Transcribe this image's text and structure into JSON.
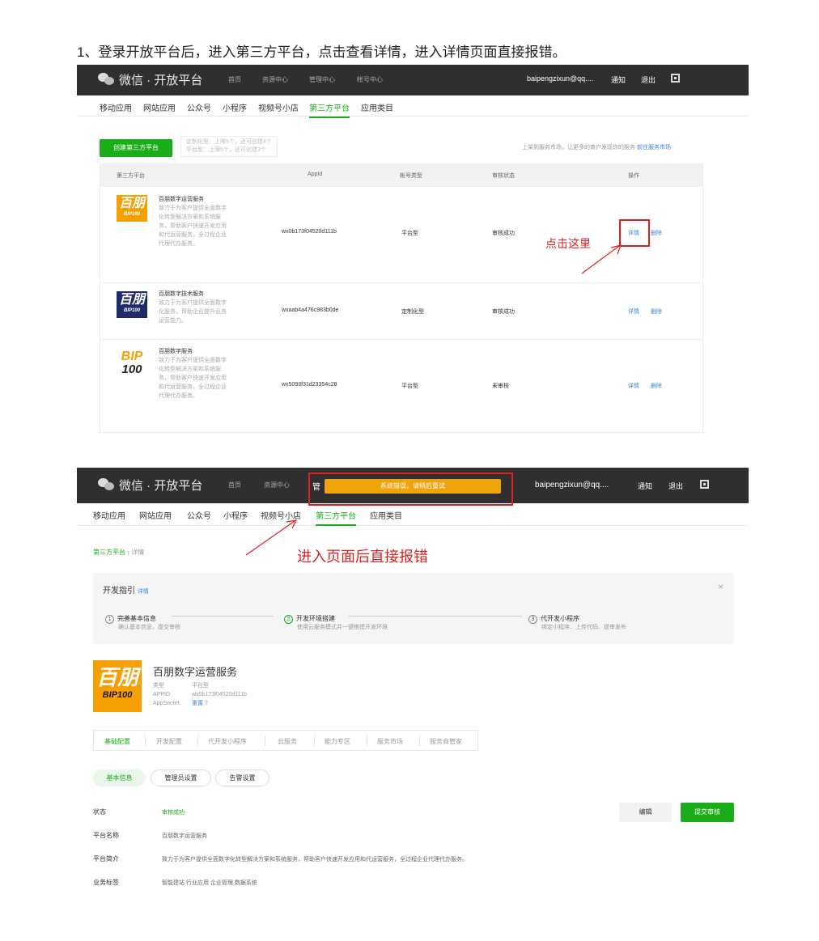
{
  "heading": "1、登录开放平台后，进入第三方平台，点击查看详情，进入详情页面直接报错。",
  "topbar": {
    "brand": "微信 · 开放平台",
    "nav": [
      "首页",
      "资源中心",
      "管理中心",
      "帐号中心"
    ],
    "account": "baipengzixun@qq....",
    "notice": "通知",
    "logout": "退出"
  },
  "subnav": [
    "移动应用",
    "网站应用",
    "公众号",
    "小程序",
    "视频号小店",
    "第三方平台",
    "应用类目"
  ],
  "list_page": {
    "create_button": "创建第三方平台",
    "quota_line1": "定制化型：上限5个，还可创建4个",
    "quota_line2": "平台型：上限5个，还可创建3个",
    "market_note": "上架到服务市场，让更多的商户发现你的服务",
    "market_link": "前往服务市场",
    "columns": [
      "第三方平台",
      "AppId",
      "帐号类型",
      "审核状态",
      "操作"
    ],
    "rows": [
      {
        "logo_top": "百朋",
        "logo_bottom": "BIP100",
        "name": "百朋数字运营服务",
        "desc": "致力于为客户提供全面数字化转型解决方案和系统服务，帮助客户快速开发应用和代运营服务，全过程企业代理代办服务。",
        "appid": "wx0b173f04520d111b",
        "type": "平台型",
        "status": "审核成功",
        "detail": "详情",
        "delete": "删除"
      },
      {
        "logo_top": "百朋",
        "logo_bottom": "BIP100",
        "name": "百朋数字技术服务",
        "desc": "致力于为客户提供全面数字化服务，帮助企业提升业务运营能力。",
        "appid": "wxaab4a476c983b0de",
        "type": "定制化型",
        "status": "审核成功",
        "detail": "详情",
        "delete": "删除"
      },
      {
        "logo_top": "BIP",
        "logo_bottom": "100",
        "name": "百朋数字服务",
        "desc": "致力于为客户提供全面数字化转型解决方案和系统服务，帮助客户快速开发应用和代运营服务，全过程企业代理代办服务。",
        "appid": "wx5093f31d23354c28",
        "type": "平台型",
        "status": "未审核",
        "detail": "详情",
        "delete": "删除"
      }
    ],
    "annotation": "点击这里"
  },
  "detail_page": {
    "partial_nav": "管",
    "error_toast": "系统错误，请稍后重试",
    "annotation": "进入页面后直接报错",
    "breadcrumb_root": "第三方平台",
    "breadcrumb_sep": "›",
    "breadcrumb_current": "详情",
    "guide_title": "开发指引",
    "guide_link": "详情",
    "close": "×",
    "steps": [
      {
        "num": "1",
        "title": "完善基本信息",
        "desc": "确认基本信息、提交审核"
      },
      {
        "num": "2",
        "title": "开发环境搭建",
        "desc": "使用云服务模式并一键搭建开发环境"
      },
      {
        "num": "3",
        "title": "代开发小程序",
        "desc": "绑定小程序、上传代码、提审发布"
      }
    ],
    "logo_top": "百朋",
    "logo_bottom": "BIP100",
    "platform_name": "百朋数字运营服务",
    "type_label": "类型",
    "type_value": "平台型",
    "appid_label": "APPID",
    "appid_value": "wx0b173f04520d111b",
    "secret_label": "AppSecret",
    "secret_action": "重置",
    "tabs": [
      "基础配置",
      "开发配置",
      "代开发小程序",
      "云服务",
      "能力专区",
      "服务市场",
      "服务商管家"
    ],
    "sub_tabs": [
      "基本信息",
      "管理员设置",
      "告警设置"
    ],
    "edit_button": "编辑",
    "submit_button": "提交审核",
    "fields": [
      {
        "label": "状态",
        "value": "审核成功"
      },
      {
        "label": "平台名称",
        "value": "百朋数字运营服务"
      },
      {
        "label": "平台简介",
        "value": "致力于为客户提供全面数字化转型解决方案和系统服务，帮助客户快速开发应用和代运营服务，全过程企业代理代办服务。"
      },
      {
        "label": "业务标签",
        "value": "智能建站 行业应用 企业管理 数据系统"
      }
    ]
  },
  "colors": {
    "brand_green": "#1aad19",
    "link_blue": "#3b86d6",
    "annotation_red": "#e02020",
    "toast_orange": "#f0a30a",
    "logo_orange": "#f5a000",
    "logo_navy": "#1f2a6b"
  }
}
